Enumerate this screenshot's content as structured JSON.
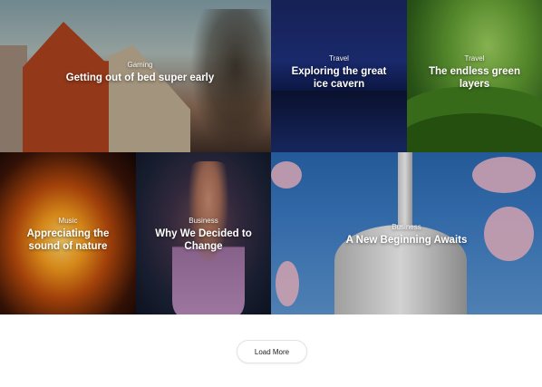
{
  "posts": [
    {
      "category": "Gaming",
      "title": "Getting out of bed super early"
    },
    {
      "category": "Travel",
      "title": "Exploring the great ice cavern"
    },
    {
      "category": "Travel",
      "title": "The endless green layers"
    },
    {
      "category": "Music",
      "title": "Appreciating the sound of nature"
    },
    {
      "category": "Business",
      "title": "Why We Decided to Change"
    },
    {
      "category": "Business",
      "title": "A New Beginning Awaits"
    }
  ],
  "load_more_label": "Load More",
  "colors": {
    "caption_text": "#ffffff",
    "button_border": "#e3e3e3",
    "button_text": "#222222",
    "page_background": "#ffffff"
  }
}
